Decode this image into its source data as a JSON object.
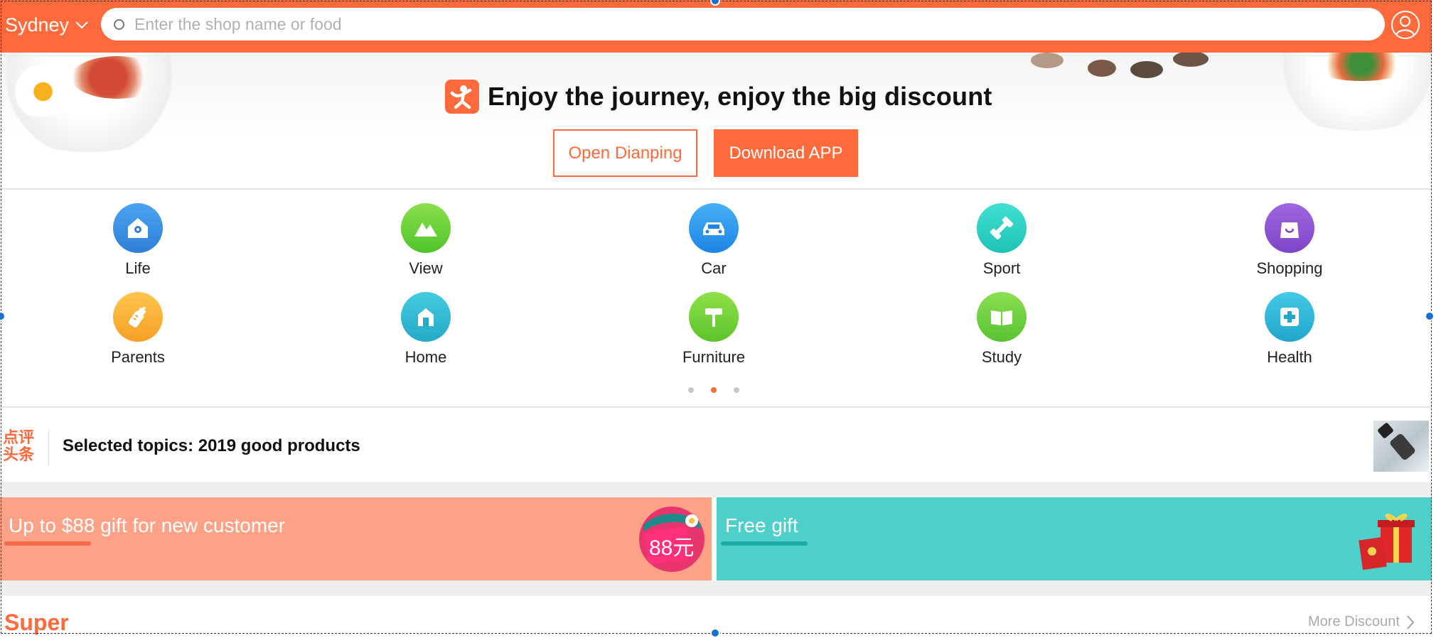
{
  "header": {
    "city": "Sydney",
    "search_placeholder": "Enter the shop name or food"
  },
  "banner": {
    "title": "Enjoy the journey, enjoy the big discount",
    "open_button": "Open Dianping",
    "download_button": "Download APP"
  },
  "categories": [
    {
      "label": "Life",
      "icon": "home-pin-icon",
      "color": "#3a8fe0"
    },
    {
      "label": "View",
      "icon": "mountain-icon",
      "color": "#6fd23a"
    },
    {
      "label": "Car",
      "icon": "car-icon",
      "color": "#2f9cf0"
    },
    {
      "label": "Sport",
      "icon": "dumbbell-icon",
      "color": "#2fd3c6"
    },
    {
      "label": "Shopping",
      "icon": "shopping-bag-icon",
      "color": "#8e57d6"
    },
    {
      "label": "Parents",
      "icon": "baby-bottle-icon",
      "color": "#f9b23a"
    },
    {
      "label": "Home",
      "icon": "house-icon",
      "color": "#33bcd6"
    },
    {
      "label": "Furniture",
      "icon": "paint-roller-icon",
      "color": "#7bd23a"
    },
    {
      "label": "Study",
      "icon": "book-icon",
      "color": "#74d23f"
    },
    {
      "label": "Health",
      "icon": "medical-cross-icon",
      "color": "#2fbcd8"
    }
  ],
  "pager": {
    "pages": 3,
    "active": 2
  },
  "topics": {
    "logo_line1": "点评",
    "logo_line2": "头条",
    "text": "Selected topics: 2019 good products"
  },
  "promos": [
    {
      "text": "Up to $88 gift for new customer",
      "badge": "88元",
      "color": "#fda286",
      "accent": "#f56b4a"
    },
    {
      "text": "Free gift",
      "color": "#4ecfca",
      "accent": "#21aba6"
    }
  ],
  "section": {
    "title": "Super",
    "more": "More Discount"
  }
}
